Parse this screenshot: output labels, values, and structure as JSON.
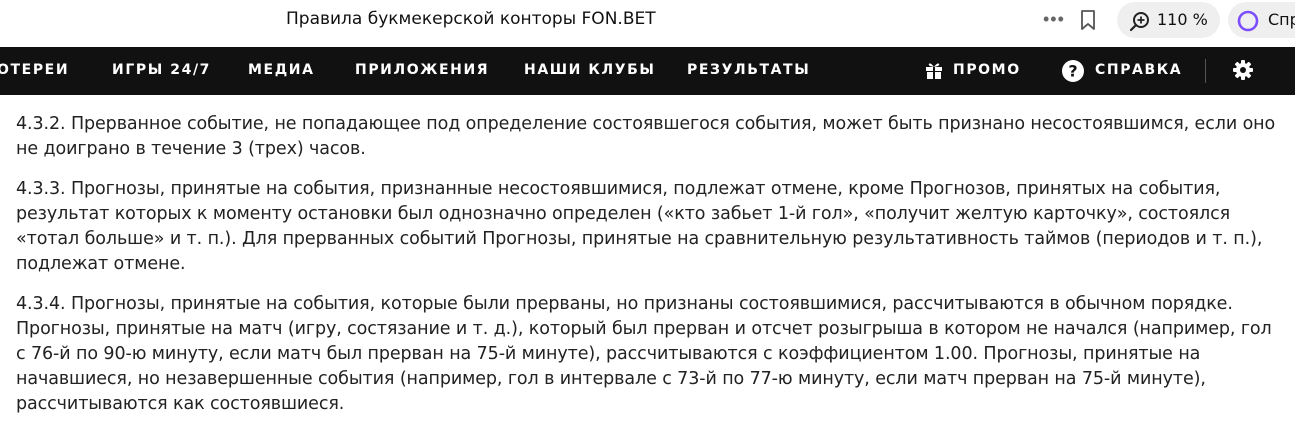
{
  "browser": {
    "tab_title": "Правила букмекерской конторы FON.BET",
    "more_label": "•••",
    "zoom_label": "110 %",
    "assistant_label": "Спр"
  },
  "nav": {
    "items": [
      "ОТЕРЕИ",
      "ИГРЫ 24/7",
      "МЕДИА",
      "ПРИЛОЖЕНИЯ",
      "НАШИ КЛУБЫ",
      "РЕЗУЛЬТАТЫ"
    ],
    "promo_label": "ПРОМО",
    "help_label": "СПРАВКА",
    "icons": [
      "gift-icon",
      "help-icon",
      "gear-icon"
    ]
  },
  "content": {
    "paragraphs": [
      "4.3.2. Прерванное событие, не попадающее под определение состоявшегося события, может быть признано несостоявшимся, если оно не доиграно в течение 3 (трех) часов.",
      "4.3.3. Прогнозы, принятые на события, признанные несостоявшимися, подлежат отмене, кроме Прогнозов, принятых на события, результат которых к моменту остановки был однозначно определен («кто забьет 1-й гол», «получит желтую карточку», состоялся «тотал больше» и т. п.). Для прерванных событий Прогнозы, принятые на сравнительную результативность таймов (периодов и т. п.), подлежат отмене.",
      "4.3.4. Прогнозы, принятые на события, которые были прерваны, но признаны состоявшимися, рассчитываются в обычном порядке. Прогнозы, принятые на матч (игру, состязание и т. д.), который был прерван и отсчет розыгрыша в котором не начался (например, гол с 76-й по 90-ю минуту, если матч был прерван на 75-й минуте), рассчитываются с коэффициентом 1.00. Прогнозы, принятые на начавшиеся, но незавершенные события (например, гол в интервале с 73-й по 77-ю минуту, если матч прерван на 75-й минуте), рассчитываются как состоявшиеся."
    ]
  },
  "colors": {
    "nav_background": "#111111",
    "accent_assistant": "#7b4dff"
  }
}
